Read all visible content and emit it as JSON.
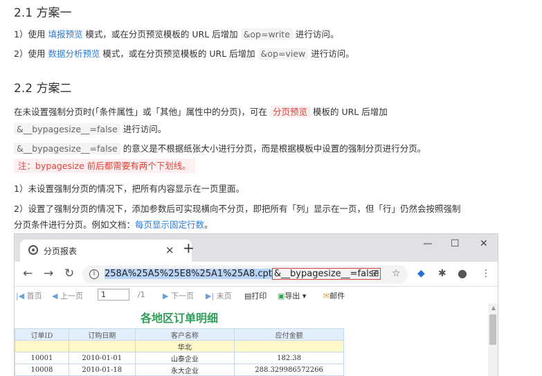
{
  "section1": {
    "heading": "2.1 方案一",
    "line1": {
      "pre": "1）使用 ",
      "link": "填报预览",
      "mid": " 模式，或在分页预览模板的 URL 后增加 ",
      "code": "&op=write",
      "post": " 进行访问。"
    },
    "line2": {
      "pre": "2）使用 ",
      "link": "数据分析预览",
      "mid": " 模式，或在分页预览模板的 URL 后增加 ",
      "code": "&op=view",
      "post": " 进行访问。"
    }
  },
  "section2": {
    "heading": "2.2 方案二",
    "p1": {
      "pre": "在未设置强制分页时(「条件属性」或「其他」属性中的分页)，可在 ",
      "red": "分页预览",
      "post": " 模板的 URL 后增加"
    },
    "p1b": {
      "code": "&__bypagesize__=false",
      "post": " 进行访问。"
    },
    "p2": {
      "code": "&__bypagesize__=false",
      "post": " 的意义是不根据纸张大小进行分页，而是根据模板中设置的强制分页进行分页。"
    },
    "note": "注：bypagesize 前后都需要有两个下划线。",
    "p3": "1）未设置强制分页的情况下，把所有内容显示在一页里面。",
    "p4a": "2）设置了强制分页的情况下，添加参数后可实现横向不分页，即把所有「列」显示在一页，但「行」仍然会按照强制",
    "p4b": {
      "pre": "分页条件进行分页。例如文档：",
      "link": "每页显示固定行数",
      "post": "。"
    }
  },
  "browser": {
    "tab_title": "分页报表",
    "tab_close": "×",
    "new_tab": "+",
    "minimize": "—",
    "maximize": "☐",
    "close": "✕",
    "url_selected": "258A%25A5%25E8%25A1%25A8.cpt",
    "url_param": "&__bypagesize__=false",
    "toolbar": {
      "first": "首页",
      "prev": "上一页",
      "page_value": "1",
      "total": "/1",
      "next": "下一页",
      "last": "末页",
      "print": "打印",
      "export": "导出",
      "mail": "邮件"
    },
    "report": {
      "title": "各地区订单明细",
      "headers": [
        "订单ID",
        "订购日期",
        "客户名称",
        "应付金额"
      ],
      "region": "华北",
      "rows": [
        [
          "10001",
          "2010-01-01",
          "山泰企业",
          "182.38"
        ],
        [
          "10008",
          "2010-01-18",
          "永大企业",
          "288.329986572266"
        ]
      ]
    }
  }
}
